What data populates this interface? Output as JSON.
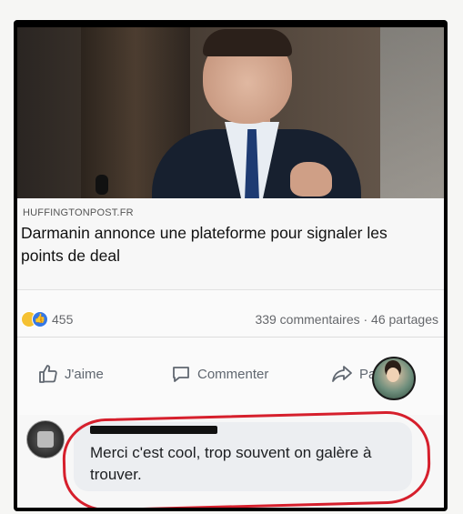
{
  "post": {
    "source": "HUFFINGTONPOST.FR",
    "headline": "Darmanin annonce une plateforme pour signaler les points de deal"
  },
  "stats": {
    "reactions_count": "455",
    "comments_shares": "339 commentaires · 46 partages"
  },
  "actions": {
    "like_label": "J'aime",
    "comment_label": "Commenter",
    "share_label": "Partager"
  },
  "comment": {
    "text": "Merci c'est cool, trop souvent on galère à trouver."
  },
  "colors": {
    "like_blue": "#3578e5",
    "highlight_red": "#d61f2c",
    "frame_accent": "#8ea7a2"
  },
  "icons": [
    "laughing-reaction-icon",
    "like-reaction-icon",
    "thumbs-up-icon",
    "comment-bubble-icon",
    "share-arrow-icon"
  ]
}
